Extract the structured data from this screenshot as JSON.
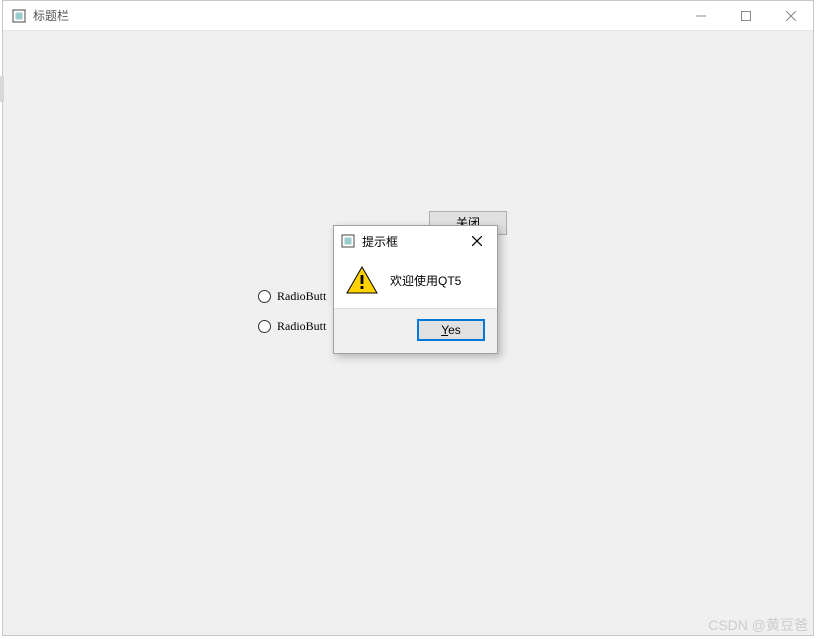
{
  "main_window": {
    "title": "标题栏",
    "close_button_label": "关闭",
    "radio1_label": "RadioButt",
    "radio2_label": "RadioButt"
  },
  "dialog": {
    "title": "提示框",
    "message": "欢迎使用QT5",
    "yes_prefix": "Y",
    "yes_suffix": "es"
  },
  "watermark": "CSDN @黄豆爸"
}
